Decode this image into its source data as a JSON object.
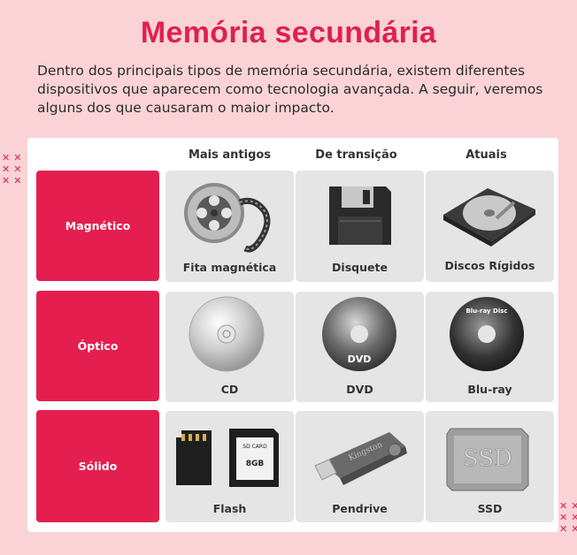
{
  "title": "Memória secundária",
  "intro": "Dentro dos principais tipos de memória secundária, existem diferentes dispositivos que aparecem como tecnologia avançada. A seguir, veremos alguns dos que causaram o maior impacto.",
  "columns": [
    "Mais antigos",
    "De transição",
    "Atuais"
  ],
  "rows": [
    {
      "label": "Magnético",
      "items": [
        {
          "caption": "Fita magnética",
          "icon": "film-reel-icon"
        },
        {
          "caption": "Disquete",
          "icon": "floppy-disk-icon"
        },
        {
          "caption": "Discos Rígidos",
          "icon": "hard-disk-icon"
        }
      ]
    },
    {
      "label": "Óptico",
      "items": [
        {
          "caption": "CD",
          "icon": "cd-icon"
        },
        {
          "caption": "DVD",
          "icon": "dvd-icon",
          "mark": "DVD"
        },
        {
          "caption": "Blu-ray",
          "icon": "bluray-icon",
          "mark": "Blu-ray Disc"
        }
      ]
    },
    {
      "label": "Sólido",
      "items": [
        {
          "caption": "Flash",
          "icon": "memory-card-icon",
          "mark_top": "SD CARD",
          "mark_size": "8GB"
        },
        {
          "caption": "Pendrive",
          "icon": "usb-drive-icon",
          "mark": "Kingston"
        },
        {
          "caption": "SSD",
          "icon": "ssd-icon",
          "mark": "SSD"
        }
      ]
    }
  ],
  "colors": {
    "accent": "#e41f4f",
    "background": "#fbd3d6",
    "cell": "#e5e5e5"
  }
}
